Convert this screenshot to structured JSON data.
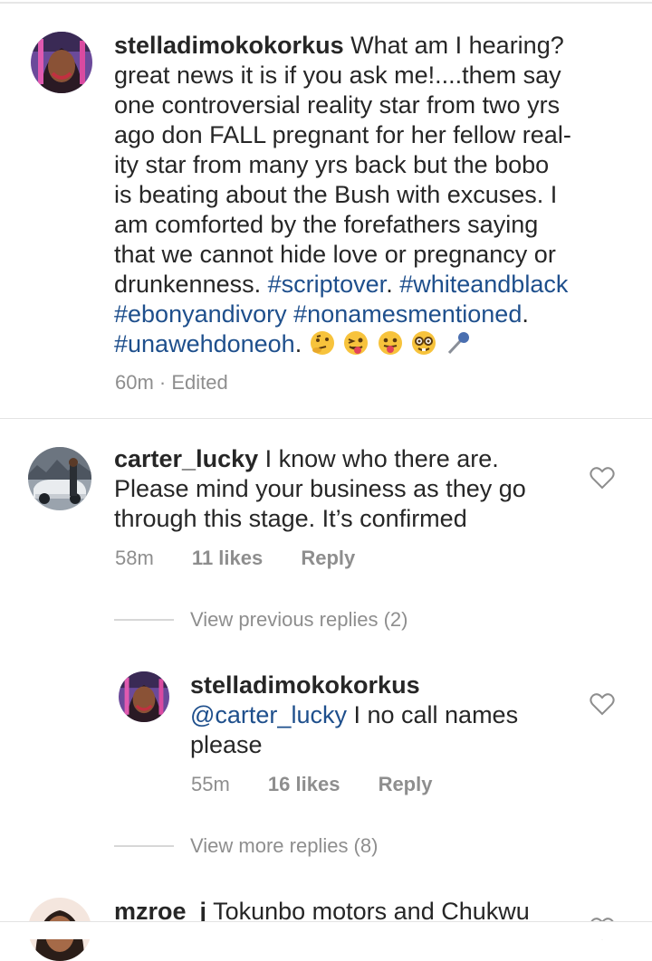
{
  "comments": {
    "main": {
      "username": "stelladimokokorkus",
      "text": "What am I hearing? great news it is if you ask me!....them say one controversial reality star from two yrs ago don FALL pregnant for her fellow reality star from many yrs back but the bobo is beating about the Bush with excuses. I am comforted by the forefathers saying that we cannot hide love or pregnancy or drunkenness.",
      "line1": "What am I hearing?",
      "line2": "great news it is if you ask me!....them say",
      "line3": "one controversial reality star from two yrs",
      "line4": "ago don FALL pregnant for her fellow real-",
      "line5": "ity star from many yrs back but the bobo",
      "line6": "is beating about the Bush with excuses. I",
      "line7": "am comforted by the forefathers saying",
      "line8": "that we cannot hide love or pregnancy or",
      "line9": "drunkenness.",
      "hashtags": [
        "#scriptover",
        "#whiteandblack",
        "#ebonyandivory",
        "#nonamesmentioned",
        "#unawehdoneoh"
      ],
      "time": "60m",
      "edited": "· Edited",
      "emojis": [
        "thinking-face",
        "winking-tongue-face",
        "tongue-face",
        "nerd-face",
        "microphone"
      ]
    },
    "second": {
      "username": "carter_lucky",
      "line1": "I know who there are.",
      "line2": "Please mind your business as they go",
      "line3": "through this stage. It’s confirmed",
      "time": "58m",
      "likes": "11 likes",
      "reply": "Reply"
    },
    "view_previous": "View previous replies (2)",
    "reply1": {
      "username": "stelladimokokorkus",
      "mention": "@carter_lucky",
      "line1": "I no call names",
      "line2": "please",
      "time": "55m",
      "likes": "16 likes",
      "reply": "Reply"
    },
    "view_more": "View more replies (8)",
    "third": {
      "username": "mzroe_j",
      "text": "Tokunbo motors and Chukwu"
    }
  },
  "colors": {
    "text": "#262626",
    "muted": "#8e8e8e",
    "hashtag": "#1e4f8c"
  }
}
